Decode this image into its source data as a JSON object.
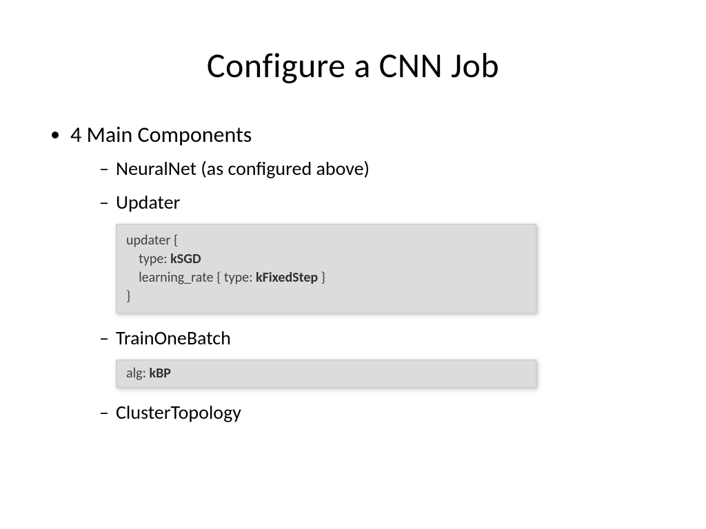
{
  "title": "Configure a CNN Job",
  "level1": "4 Main Components",
  "sub": {
    "a": "NeuralNet (as configured above)",
    "b": "Updater",
    "c": "TrainOneBatch",
    "d": "ClusterTopology"
  },
  "code1": {
    "l1a": "updater {",
    "l2a": "    type: ",
    "l2b": "kSGD",
    "l3a": "    learning_rate { type: ",
    "l3b": "kFixedStep",
    "l3c": " }",
    "l4a": "}"
  },
  "code2": {
    "a": "alg: ",
    "b": "kBP"
  }
}
